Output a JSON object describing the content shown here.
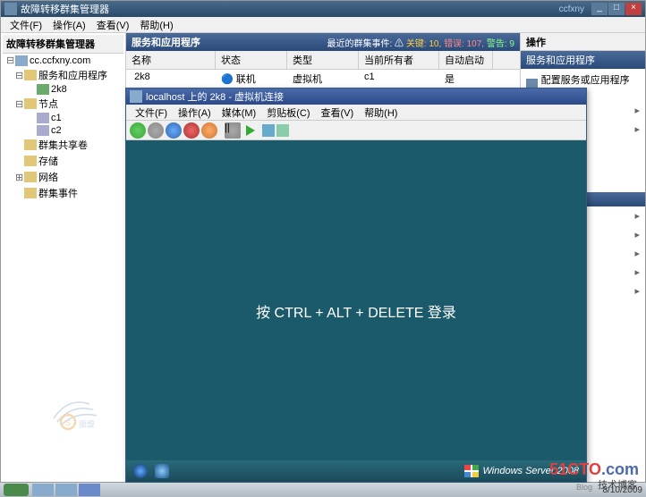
{
  "mainWindow": {
    "title": "故障转移群集管理器",
    "user": "ccfxny",
    "menu": {
      "file": "文件(F)",
      "action": "操作(A)",
      "view": "查看(V)",
      "help": "帮助(H)"
    }
  },
  "tree": {
    "header": "故障转移群集管理器",
    "root": "cc.ccfxny.com",
    "services": "服务和应用程序",
    "vm1": "2k8",
    "nodes": "节点",
    "node1": "c1",
    "node2": "c2",
    "csv": "群集共享卷",
    "storage": "存储",
    "network": "网络",
    "events": "群集事件"
  },
  "center": {
    "title": "服务和应用程序",
    "eventsLabel": "最近的群集事件:",
    "warnLabel": "关键: 10,",
    "errLabel": "错误: 107,",
    "alertLabel": "警告: 9",
    "cols": {
      "name": "名称",
      "status": "状态",
      "type": "类型",
      "owner": "当前所有者",
      "auto": "自动启动"
    },
    "row": {
      "name": "2k8",
      "status": "联机",
      "type": "虚拟机",
      "owner": "c1",
      "auto": "是"
    }
  },
  "actions": {
    "header": "操作",
    "sub": "服务和应用程序",
    "configure": "配置服务或应用程序(S)..."
  },
  "vmWindow": {
    "title": "localhost 上的 2k8 - 虚拟机连接",
    "menu": {
      "file": "文件(F)",
      "action": "操作(A)",
      "media": "媒体(M)",
      "clipboard": "剪贴板(C)",
      "view": "查看(V)",
      "help": "帮助(H)"
    },
    "loginText": "按 CTRL + ALT + DELETE 登录",
    "brand": "Windows Server 2008"
  },
  "host": {
    "date": "8/10/2009"
  },
  "watermark": {
    "site1": "51CTO",
    "siteExt": ".com",
    "site2": "技术博客",
    "blog": "Blog"
  }
}
